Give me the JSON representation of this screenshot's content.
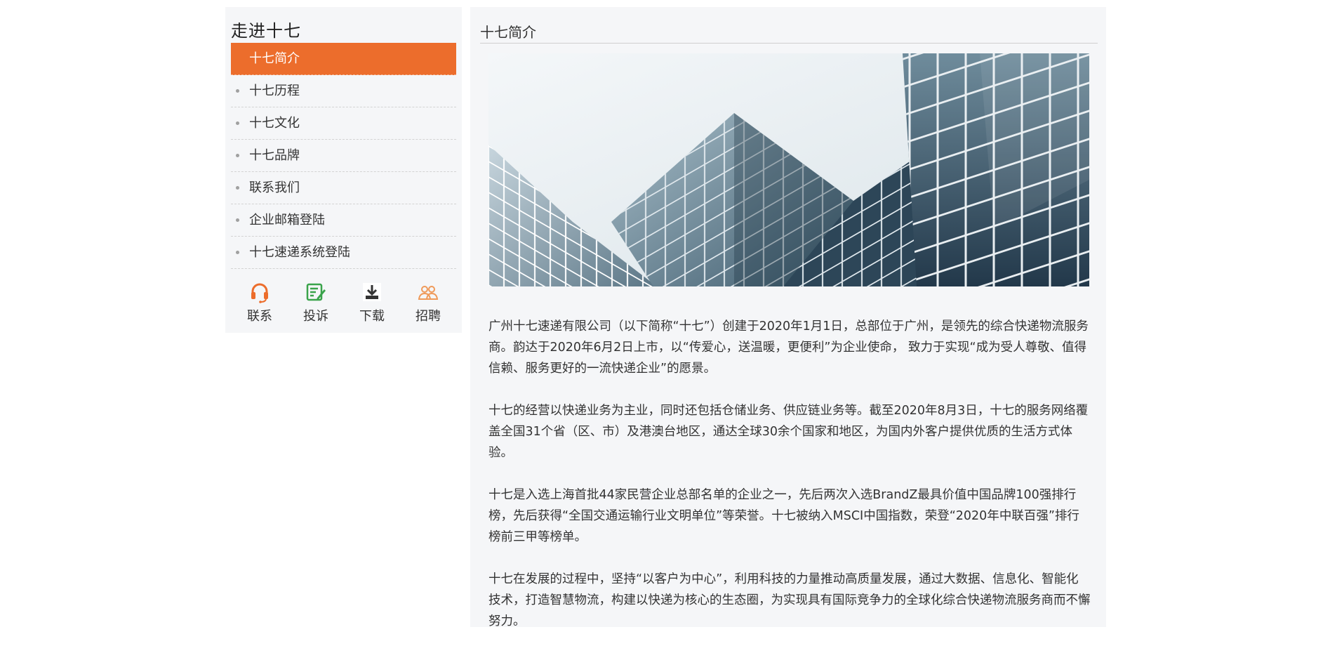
{
  "sidebar": {
    "title": "走进十七",
    "items": [
      {
        "label": "十七简介",
        "active": true
      },
      {
        "label": "十七历程"
      },
      {
        "label": "十七文化"
      },
      {
        "label": "十七品牌"
      },
      {
        "label": "联系我们"
      },
      {
        "label": "企业邮箱登陆"
      },
      {
        "label": "十七速递系统登陆"
      }
    ],
    "quick_links": [
      {
        "label": "联系",
        "icon": "headset-icon",
        "color": "#ec6d2c"
      },
      {
        "label": "投诉",
        "icon": "complaint-icon",
        "color": "#3aa34b"
      },
      {
        "label": "下载",
        "icon": "download-icon",
        "color": "#333333"
      },
      {
        "label": "招聘",
        "icon": "people-icon",
        "color": "#ef9a5a"
      }
    ]
  },
  "content": {
    "title": "十七简介",
    "paragraphs": [
      "广州十七速递有限公司（以下简称“十七”）创建于2020年1月1日，总部位于广州，是领先的综合快递物流服务商。韵达于2020年6月2日上市，以“传爱心，送温暖，更便利”为企业使命， 致力于实现“成为受人尊敬、值得信赖、服务更好的一流快递企业”的愿景。",
      "十七的经营以快递业务为主业，同时还包括仓储业务、供应链业务等。截至2020年8月3日，十七的服务网络覆盖全国31个省（区、市）及港澳台地区，通达全球30余个国家和地区，为国内外客户提供优质的生活方式体验。",
      "十七是入选上海首批44家民营企业总部名单的企业之一，先后两次入选BrandZ最具价值中国品牌100强排行榜，先后获得“全国交通运输行业文明单位”等荣誉。十七被纳入MSCI中国指数，荣登“2020年中联百强”排行榜前三甲等榜单。",
      "十七在发展的过程中，坚持“以客户为中心”，利用科技的力量推动高质量发展，通过大数据、信息化、智能化技术，打造智慧物流，构建以快递为核心的生态圈，为实现具有国际竞争力的全球化综合快递物流服务商而不懈努力。"
    ]
  },
  "colors": {
    "accent": "#ec6d2c",
    "panel_bg": "#f5f6f8"
  }
}
